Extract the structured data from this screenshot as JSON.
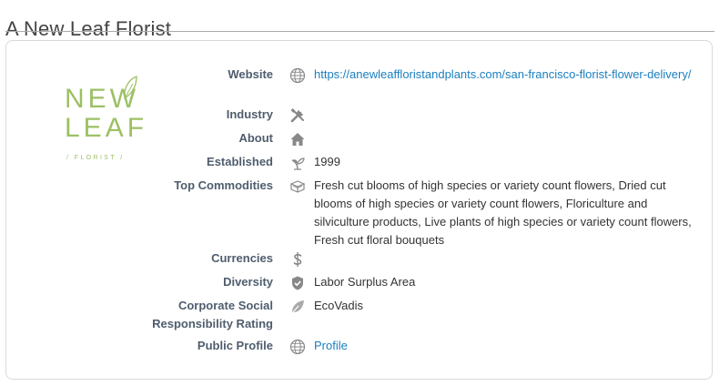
{
  "page": {
    "title": "A New Leaf Florist"
  },
  "logo": {
    "line1": "NEW",
    "line2": "LEAF",
    "tagline": "/ FLORIST /"
  },
  "colors": {
    "brand_green": "#9cc064",
    "link": "#1a7fbf",
    "label": "#4f5d6d",
    "icon": "#888888"
  },
  "details": {
    "website": {
      "label": "Website",
      "icon": "globe-icon",
      "value": "https://anewleaffloristandplants.com/san-francisco-florist-flower-delivery/"
    },
    "industry": {
      "label": "Industry",
      "icon": "tools-icon"
    },
    "about": {
      "label": "About",
      "icon": "home-icon"
    },
    "established": {
      "label": "Established",
      "icon": "sprout-icon",
      "value": "1999"
    },
    "commodities": {
      "label": "Top Commodities",
      "icon": "boxes-icon",
      "value": "Fresh cut blooms of high species or variety count flowers, Dried cut blooms of high species or variety count flowers, Floriculture and silviculture products, Live plants of high species or variety count flowers, Fresh cut floral bouquets"
    },
    "currencies": {
      "label": "Currencies",
      "icon": "dollar-icon"
    },
    "diversity": {
      "label": "Diversity",
      "icon": "shield-check-icon",
      "value": "Labor Surplus Area"
    },
    "csr": {
      "label_line1": "Corporate Social",
      "label_line2": "Responsibility Rating",
      "icon": "leaf-icon",
      "value": "EcoVadis"
    },
    "public_profile": {
      "label": "Public Profile",
      "icon": "globe-icon",
      "value": "Profile"
    }
  }
}
